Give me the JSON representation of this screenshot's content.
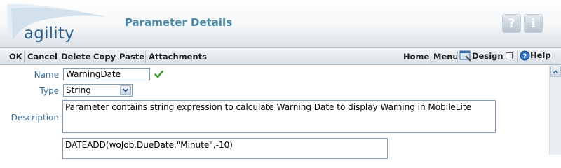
{
  "header": {
    "logo_text": "agility",
    "title": "Parameter Details",
    "help_button": "?",
    "info_button": "i"
  },
  "toolbar": {
    "left_items": [
      "OK",
      "Cancel",
      "Delete",
      "Copy",
      "Paste",
      "Attachments"
    ],
    "home": "Home",
    "menu": "Menu",
    "design": "Design",
    "help": "Help"
  },
  "form": {
    "name_label": "Name",
    "name_value": "WarningDate",
    "name_valid_icon": "checkmark-icon",
    "type_label": "Type",
    "type_value": "String",
    "description_label": "Description",
    "description_value": "Parameter contains string expression to calculate Warning Date to display Warning in MobileLite",
    "expression_value": "DATEADD(woJob.DueDate,\"Minute\",-10)"
  },
  "colors": {
    "label": "#3b6e9a",
    "title": "#4a8aa8",
    "check": "#3a9a2a"
  }
}
